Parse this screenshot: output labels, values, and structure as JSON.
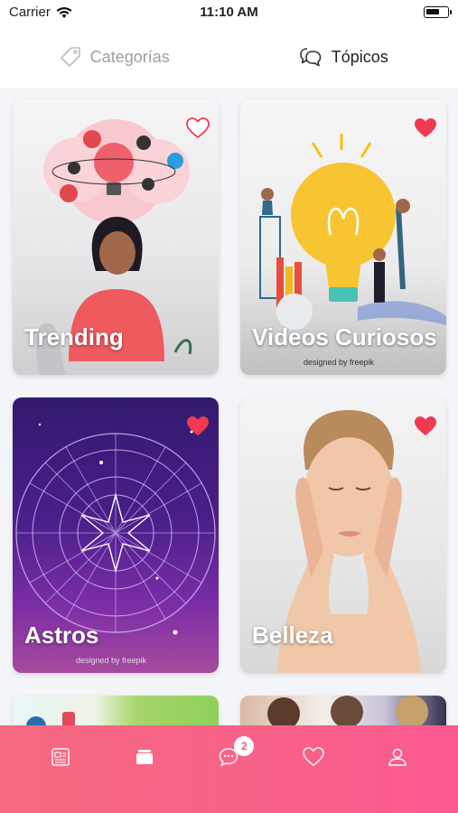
{
  "status_bar": {
    "carrier": "Carrier",
    "time": "11:10 AM"
  },
  "tabs": [
    {
      "label": "Categorías",
      "icon": "tag-icon",
      "active": false
    },
    {
      "label": "Tópicos",
      "icon": "chat-bubbles-icon",
      "active": true
    }
  ],
  "cards": [
    {
      "title": "Trending",
      "liked": false,
      "credit": ""
    },
    {
      "title": "Videos Curiosos",
      "liked": true,
      "credit": "designed by freepik"
    },
    {
      "title": "Astros",
      "liked": true,
      "credit": "designed by freepik"
    },
    {
      "title": "Belleza",
      "liked": true,
      "credit": ""
    }
  ],
  "nav": {
    "items": [
      "news-icon",
      "cards-icon",
      "chat-icon",
      "heart-icon",
      "profile-icon"
    ],
    "chat_badge": "2"
  },
  "colors": {
    "accent": "#f7627f",
    "heart": "#f03a4f"
  }
}
